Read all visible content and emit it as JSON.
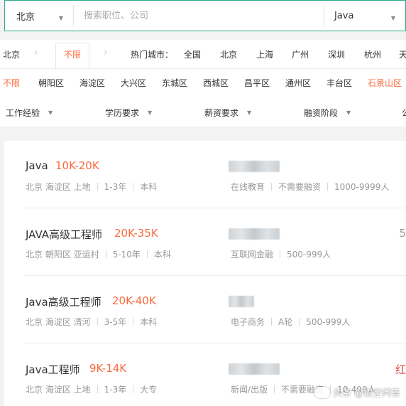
{
  "search": {
    "city": "北京",
    "placeholder": "搜索职位、公司",
    "language": "Java"
  },
  "filters": {
    "city_row": {
      "current_city": "北京",
      "unlimited": "不限",
      "hot_label": "热门城市：",
      "hot_cities": [
        "全国",
        "北京",
        "上海",
        "广州",
        "深圳",
        "杭州",
        "天"
      ]
    },
    "districts": [
      "不限",
      "朝阳区",
      "海淀区",
      "大兴区",
      "东城区",
      "西城区",
      "昌平区",
      "通州区",
      "丰台区",
      "石景山区"
    ],
    "selected_district": "不限",
    "options": [
      "工作经验",
      "学历要求",
      "薪资要求",
      "融资阶段",
      "公"
    ]
  },
  "jobs": [
    {
      "title": "Java",
      "salary": "10K-20K",
      "location": "北京 海淀区 上地",
      "experience": "1-3年",
      "education": "本科",
      "company_tags": [
        "在线教育",
        "不需要融资",
        "1000-9999人"
      ],
      "edge": ""
    },
    {
      "title": "JAVA高级工程师",
      "salary": "20K-35K",
      "location": "北京 朝阳区 亚运村",
      "experience": "5-10年",
      "education": "本科",
      "company_tags": [
        "互联网金融",
        "500-999人"
      ],
      "edge": "5"
    },
    {
      "title": "Java高级工程师",
      "salary": "20K-40K",
      "location": "北京 海淀区 清河",
      "experience": "3-5年",
      "education": "本科",
      "company_tags": [
        "电子商务",
        "A轮",
        "500-999人"
      ],
      "edge": ""
    },
    {
      "title": "Java工程师",
      "salary": "9K-14K",
      "location": "北京 海淀区 上地",
      "experience": "1-3年",
      "education": "大专",
      "company_tags": [
        "新闻/出版",
        "不需要融资",
        "10-499人"
      ],
      "edge": "红"
    }
  ],
  "watermark": "头条 @悟空问答",
  "colors": {
    "accent_green": "#2aa98c",
    "salary_orange": "#fa6a3d",
    "selected_orange": "#ff6a3d"
  }
}
